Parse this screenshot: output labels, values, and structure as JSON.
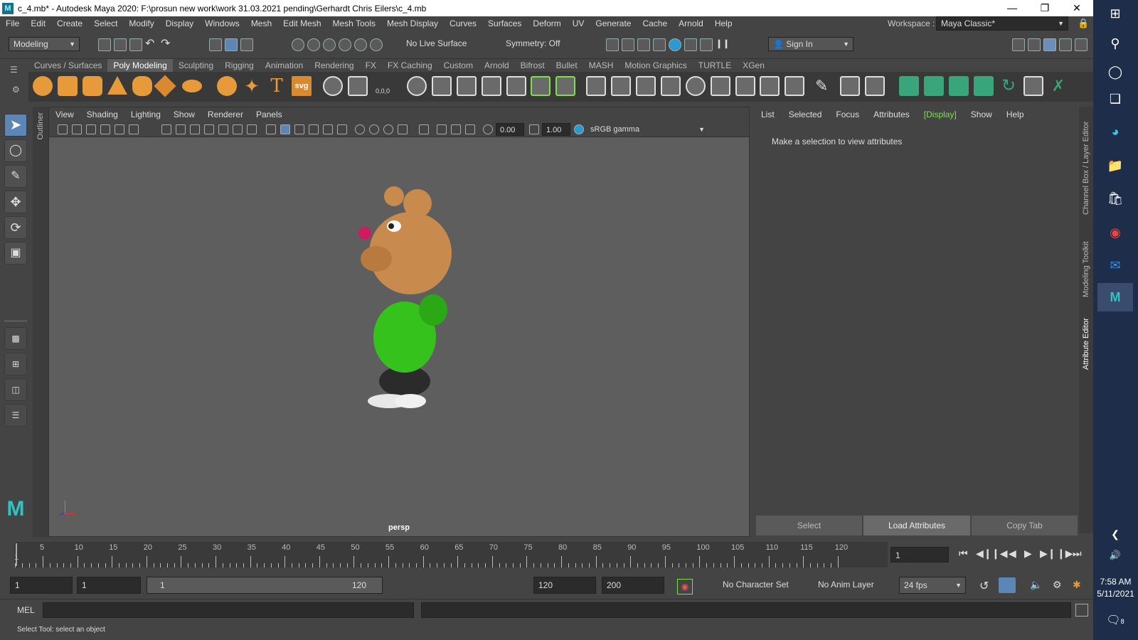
{
  "window": {
    "title": "c_4.mb* - Autodesk Maya 2020: F:\\prosun new work\\work 31.03.2021 pending\\Gerhardt Chris Eilers\\c_4.mb",
    "logo": "M"
  },
  "menubar": [
    "File",
    "Edit",
    "Create",
    "Select",
    "Modify",
    "Display",
    "Windows",
    "Mesh",
    "Edit Mesh",
    "Mesh Tools",
    "Mesh Display",
    "Curves",
    "Surfaces",
    "Deform",
    "UV",
    "Generate",
    "Cache",
    "Arnold",
    "Help"
  ],
  "workspace": {
    "label": "Workspace :",
    "value": "Maya Classic*"
  },
  "statusline": {
    "mode": "Modeling",
    "live_surface": "No Live Surface",
    "symmetry": "Symmetry: Off",
    "sign_in": "Sign In"
  },
  "shelf_tabs": [
    "Curves / Surfaces",
    "Poly Modeling",
    "Sculpting",
    "Rigging",
    "Animation",
    "Rendering",
    "FX",
    "FX Caching",
    "Custom",
    "Arnold",
    "Bifrost",
    "Bullet",
    "MASH",
    "Motion Graphics",
    "TURTLE",
    "XGen"
  ],
  "shelf_active": "Poly Modeling",
  "shelf_icons": {
    "text_tool": "T",
    "svg_tool": "svg",
    "sphere_value": "0,0,0"
  },
  "viewport": {
    "menus": [
      "View",
      "Shading",
      "Lighting",
      "Show",
      "Renderer",
      "Panels"
    ],
    "exposure": "0.00",
    "gamma": "1.00",
    "color_space": "sRGB gamma",
    "camera": "persp"
  },
  "outliner_label": "Outliner",
  "attribute_editor": {
    "menus": [
      "List",
      "Selected",
      "Focus",
      "Attributes",
      "[Display]",
      "Show",
      "Help"
    ],
    "message": "Make a selection to view attributes",
    "buttons": [
      "Select",
      "Load Attributes",
      "Copy Tab"
    ]
  },
  "right_strips": [
    "Channel Box / Layer Editor",
    "Modeling Toolkit",
    "Attribute Editor"
  ],
  "timeline": {
    "ticks": [
      "5",
      "10",
      "15",
      "20",
      "25",
      "30",
      "35",
      "40",
      "45",
      "50",
      "55",
      "60",
      "65",
      "70",
      "75",
      "80",
      "85",
      "90",
      "95",
      "100",
      "105",
      "110",
      "115",
      "120"
    ],
    "start_marker": "1",
    "current_frame": "1"
  },
  "range": {
    "start": "1",
    "anim_start": "1",
    "slider_start": "1",
    "slider_end": "120",
    "end": "120",
    "anim_end": "200",
    "character_set": "No Character Set",
    "anim_layer": "No Anim Layer",
    "fps": "24 fps"
  },
  "command": {
    "label": "MEL"
  },
  "help_line": "Select Tool: select an object",
  "taskbar": {
    "time": "7:58 AM",
    "date": "5/11/2021",
    "notif_count": "8"
  },
  "colors": {
    "accent": "#5b86b6",
    "display_tag": "#7ee04a",
    "maya_bg": "#444444",
    "taskbar": "#1e2e4a"
  }
}
